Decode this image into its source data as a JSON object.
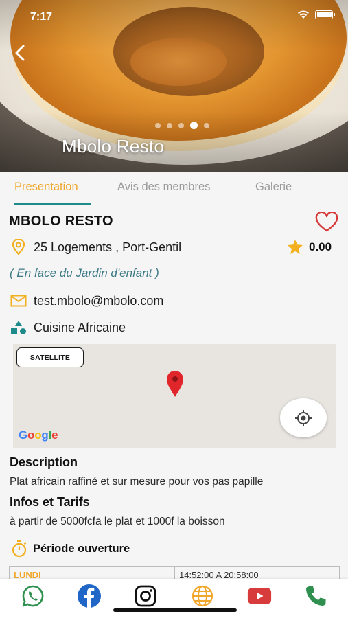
{
  "status_bar": {
    "time": "7:17"
  },
  "hero": {
    "title": "Mbolo Resto",
    "carousel_dots": 5,
    "active_dot": 4
  },
  "tabs": [
    {
      "label": "Presentation",
      "active": true
    },
    {
      "label": "Avis des membres",
      "active": false
    },
    {
      "label": "Galerie",
      "active": false
    }
  ],
  "restaurant": {
    "name": "MBOLO RESTO",
    "address": "25 Logements , Port-Gentil",
    "rating": "0.00",
    "landmark": "( En face du Jardin d'enfant )",
    "email": "test.mbolo@mbolo.com",
    "cuisine": "Cuisine Africaine"
  },
  "map": {
    "satellite_label": "SATELLITE",
    "provider_logo": "Google"
  },
  "description": {
    "title": "Description",
    "text": "Plat africain raffiné et sur mesure pour vos pas papille"
  },
  "tarifs": {
    "title": "Infos et Tarifs",
    "text": "à partir de 5000fcfa le plat et 1000f la boisson"
  },
  "opening": {
    "title": "Période ouverture",
    "rows": [
      {
        "day": "LUNDI",
        "hours": "14:52:00 A 20:58:00"
      }
    ]
  },
  "colors": {
    "accent_orange": "#f0a72c",
    "teal": "#1f8a8a",
    "heart_red": "#d83a3a",
    "star_gold": "#f2b01e",
    "whatsapp_green": "#2f8f4e",
    "facebook_blue": "#1f66c7",
    "youtube_red": "#d83b3b"
  },
  "bottom_bar": [
    {
      "icon": "whatsapp-icon"
    },
    {
      "icon": "facebook-icon"
    },
    {
      "icon": "instagram-icon"
    },
    {
      "icon": "globe-icon"
    },
    {
      "icon": "youtube-icon"
    },
    {
      "icon": "phone-icon"
    }
  ]
}
